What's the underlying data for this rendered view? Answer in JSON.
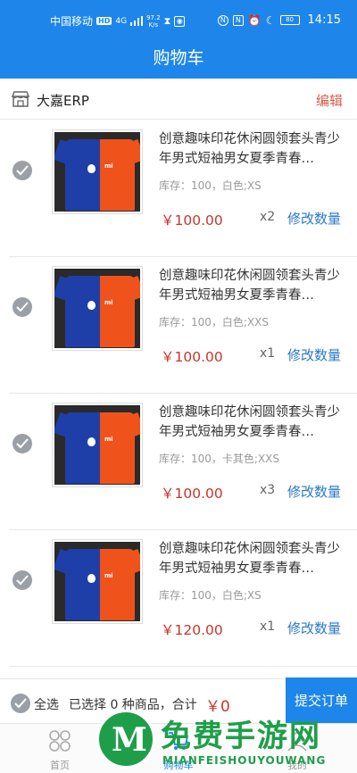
{
  "status_bar": {
    "carrier": "中国移动",
    "hd": "HD",
    "signal": "4G",
    "speed": "97.2",
    "speed_unit": "K/s",
    "battery": "80",
    "time": "14:15"
  },
  "header": {
    "title": "购物车"
  },
  "shop": {
    "name": "大嘉ERP",
    "edit_label": "编辑"
  },
  "items": [
    {
      "title": "创意趣味印花休闲圆领套头青少年男式短袖男女夏季青春…",
      "spec": "库存：100，白色;XS",
      "price": "￥100.00",
      "qty": "x2",
      "modify_label": "修改数量"
    },
    {
      "title": "创意趣味印花休闲圆领套头青少年男式短袖男女夏季青春…",
      "spec": "库存：100，白色;XXS",
      "price": "￥100.00",
      "qty": "x1",
      "modify_label": "修改数量"
    },
    {
      "title": "创意趣味印花休闲圆领套头青少年男式短袖男女夏季青春…",
      "spec": "库存：100，卡其色;XXS",
      "price": "￥100.00",
      "qty": "x3",
      "modify_label": "修改数量"
    },
    {
      "title": "创意趣味印花休闲圆领套头青少年男式短袖男女夏季青春…",
      "spec": "库存：100，白色;XS",
      "price": "￥120.00",
      "qty": "x1",
      "modify_label": "修改数量"
    }
  ],
  "footer": {
    "select_all_label": "全选",
    "summary": "已选择 0 种商品，合计",
    "total": "￥0",
    "submit_label": "提交订单"
  },
  "tabbar": {
    "home_label": "首页",
    "cart_label": "购物车",
    "mine_label": "我的"
  },
  "watermark": {
    "text": "免费手游网",
    "sub": "MIANFEISHOUYOUWANG",
    "logo": "M"
  },
  "colors": {
    "primary": "#1e86ea",
    "price": "#c9352b",
    "edit": "#d95c4a"
  }
}
